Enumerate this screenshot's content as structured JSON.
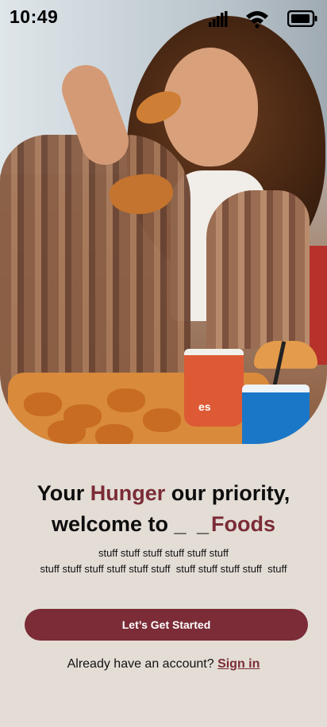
{
  "status_bar": {
    "time": "10:49",
    "signal_icon": "cellular-signal-icon",
    "wifi_icon": "wifi-icon",
    "battery_icon": "battery-icon"
  },
  "hero": {
    "image": "woman-eating-fried-chicken-photo",
    "cup_text": "es"
  },
  "headline": {
    "line1_before": "Your ",
    "line1_accent": "Hunger",
    "line1_after": " our priority,",
    "line2_before": "welcome to ",
    "line2_blank": "_ _",
    "line2_accent": "Foods"
  },
  "subtitle": {
    "line1": "stuff stuff stuff stuff stuff stuff",
    "line2": "stuff stuff stuff stuff stuff stuff  stuff stuff stuff stuff  stuff"
  },
  "cta": {
    "label": "Let’s Get Started"
  },
  "signin": {
    "prompt": "Already have an account? ",
    "link": "Sign in"
  },
  "colors": {
    "accent": "#7b2c36",
    "background": "#e3ddd6"
  }
}
